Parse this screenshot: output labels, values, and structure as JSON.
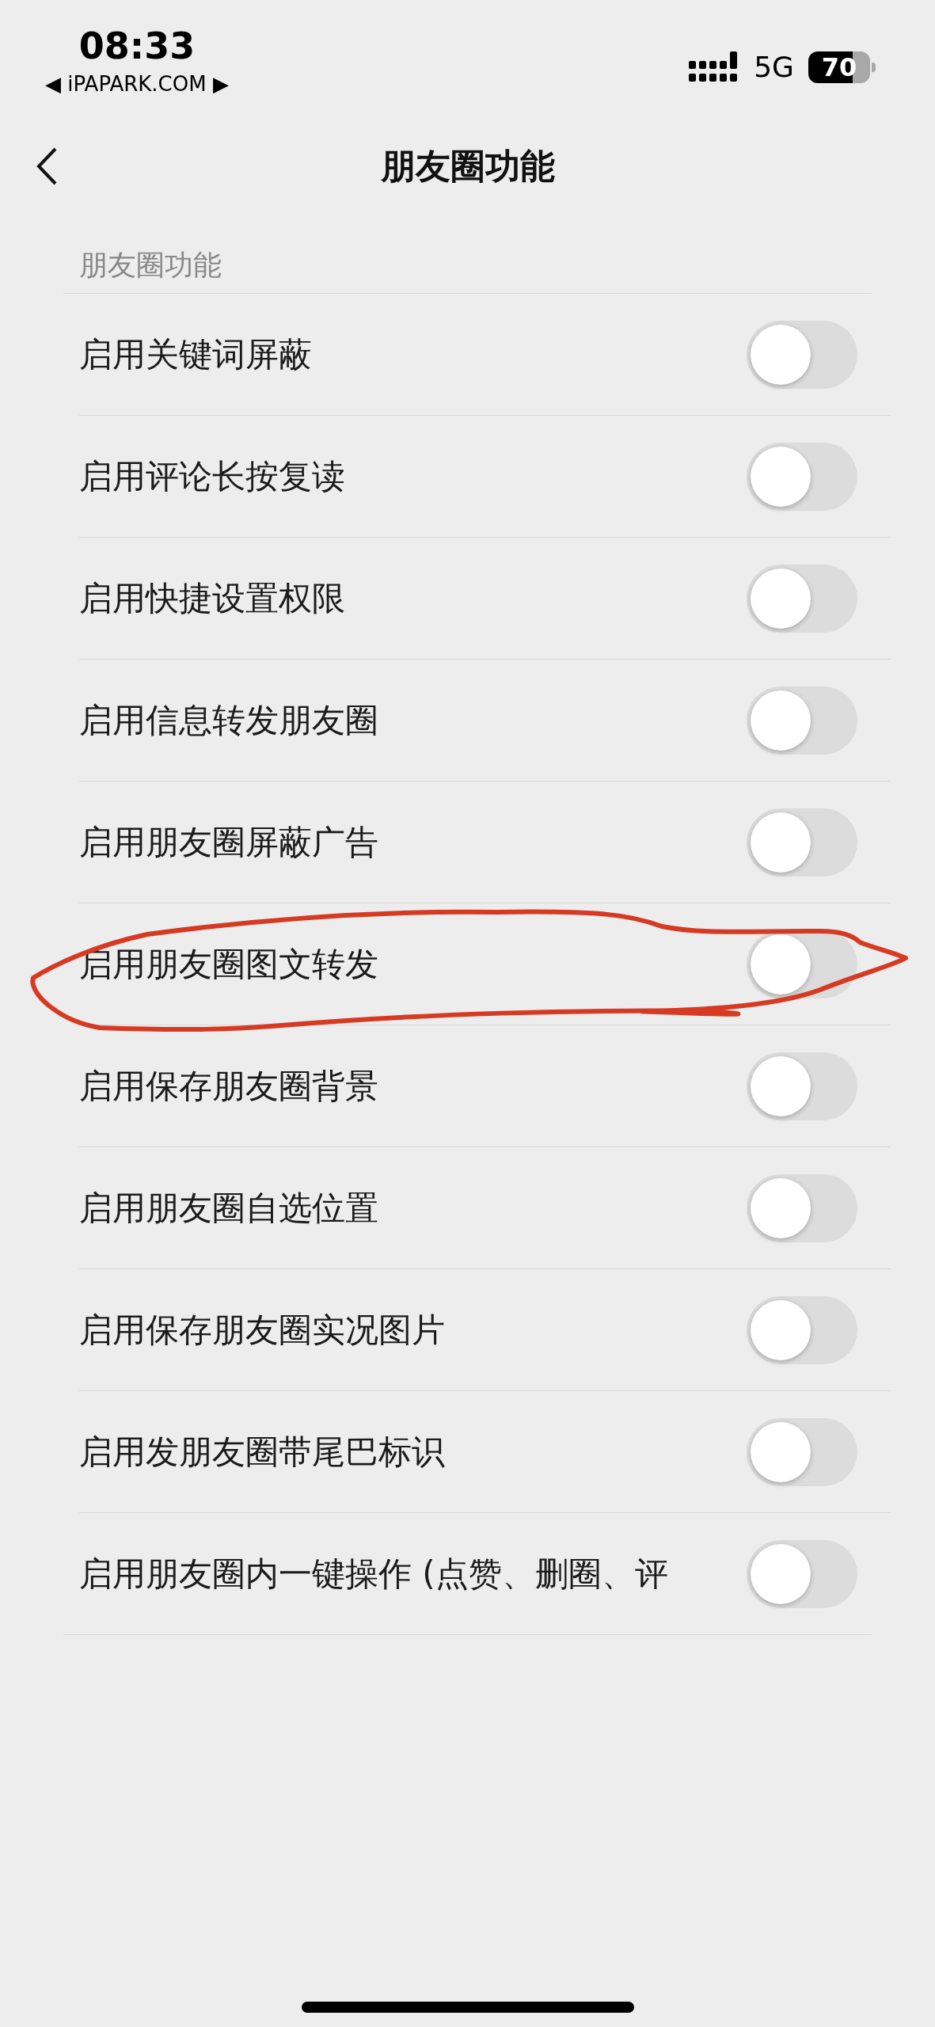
{
  "status_bar": {
    "time": "08:33",
    "carrier_link": "◀ iPAPARK.COM ▶",
    "network": "5G",
    "battery": "70"
  },
  "nav": {
    "title": "朋友圈功能"
  },
  "section": {
    "title": "朋友圈功能",
    "items": [
      {
        "label": "启用关键词屏蔽",
        "on": false
      },
      {
        "label": "启用评论长按复读",
        "on": false
      },
      {
        "label": "启用快捷设置权限",
        "on": false
      },
      {
        "label": "启用信息转发朋友圈",
        "on": false
      },
      {
        "label": "启用朋友圈屏蔽广告",
        "on": false
      },
      {
        "label": "启用朋友圈图文转发",
        "on": false
      },
      {
        "label": "启用保存朋友圈背景",
        "on": false
      },
      {
        "label": "启用朋友圈自选位置",
        "on": false
      },
      {
        "label": "启用保存朋友圈实况图片",
        "on": false
      },
      {
        "label": "启用发朋友圈带尾巴标识",
        "on": false
      },
      {
        "label": "启用朋友圈内一键操作 (点赞、删圈、评",
        "on": false
      }
    ]
  }
}
